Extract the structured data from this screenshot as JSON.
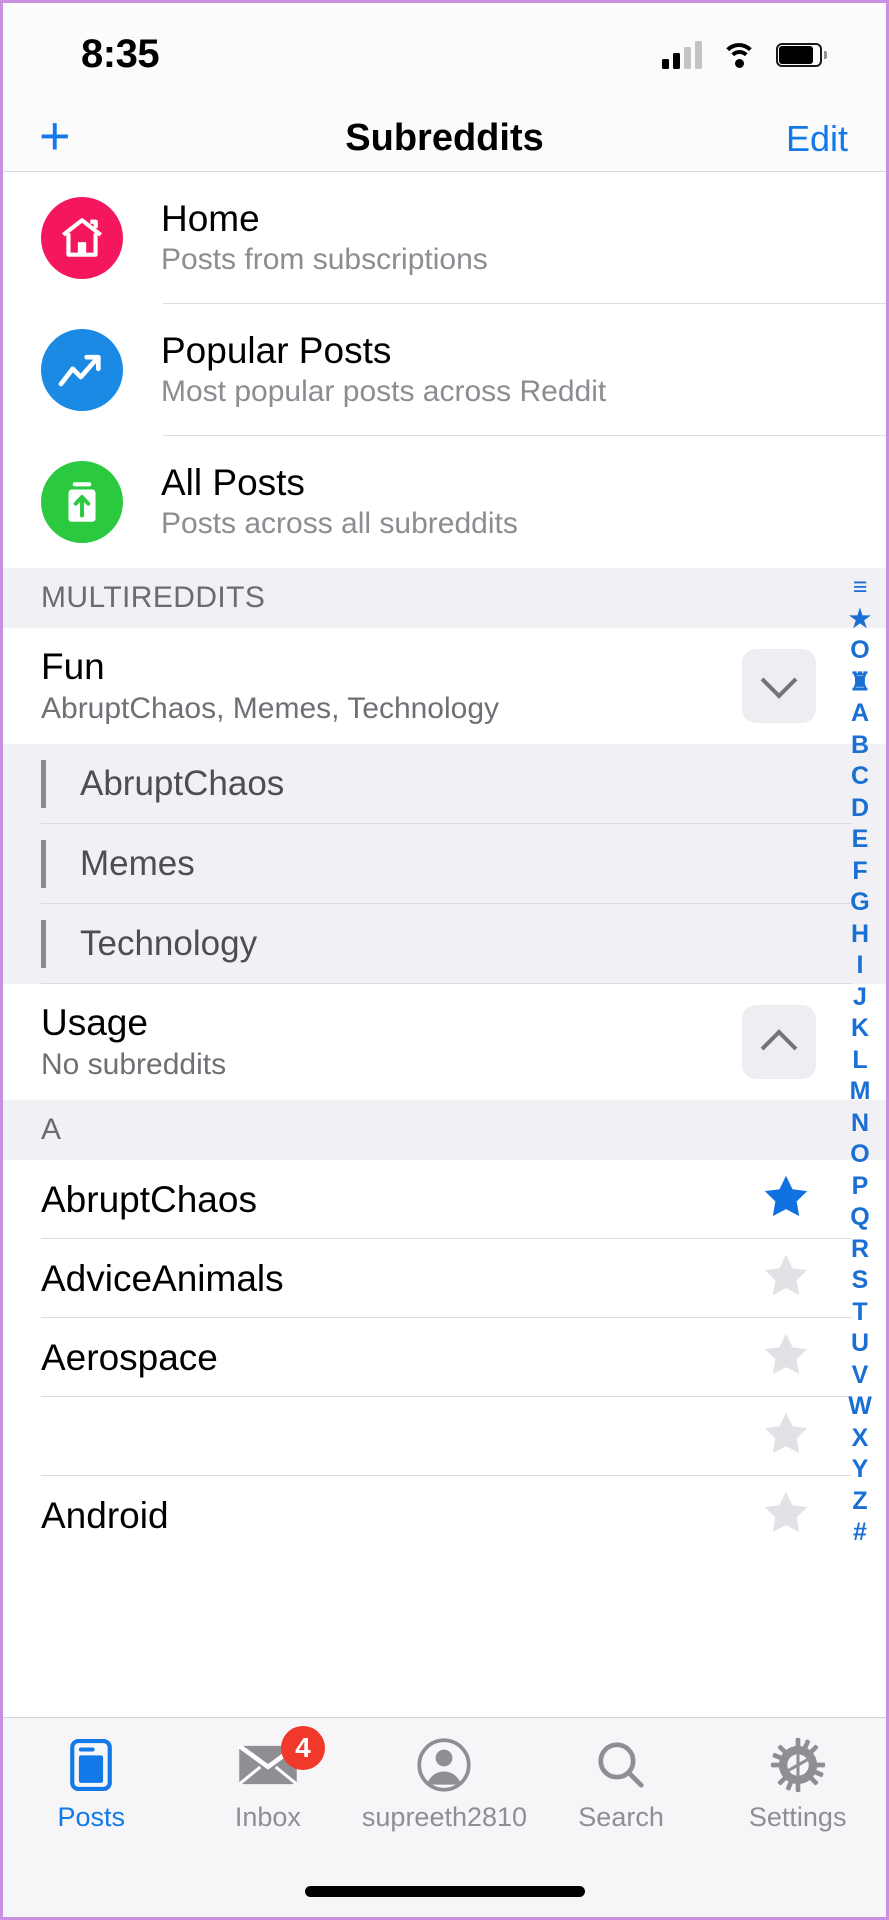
{
  "status_bar": {
    "time": "8:35",
    "cellular_icon": "cellular-signal-icon",
    "wifi_icon": "wifi-icon",
    "battery_icon": "battery-icon"
  },
  "nav_bar": {
    "add_label": "+",
    "title": "Subreddits",
    "edit_label": "Edit"
  },
  "quick_links": [
    {
      "title": "Home",
      "subtitle": "Posts from subscriptions",
      "icon": "home-icon",
      "color": "#f4175e"
    },
    {
      "title": "Popular Posts",
      "subtitle": "Most popular posts across Reddit",
      "icon": "trending-up-icon",
      "color": "#1b8ae4"
    },
    {
      "title": "All Posts",
      "subtitle": "Posts across all subreddits",
      "icon": "upload-box-icon",
      "color": "#2bc940"
    }
  ],
  "multireddits_header": "MULTIREDDITS",
  "multireddits": [
    {
      "title": "Fun",
      "subtitle": "AbruptChaos, Memes, Technology",
      "expanded": true,
      "chevron": "chevron-down-icon",
      "children": [
        "AbruptChaos",
        "Memes",
        "Technology"
      ]
    },
    {
      "title": "Usage",
      "subtitle": "No subreddits",
      "expanded": false,
      "chevron": "chevron-up-icon",
      "children": []
    }
  ],
  "alpha_section_header": "A",
  "subreddits": [
    {
      "name": "AbruptChaos",
      "favorite": true
    },
    {
      "name": "AdviceAnimals",
      "favorite": false
    },
    {
      "name": "Aerospace",
      "favorite": false
    },
    {
      "name": "",
      "favorite": false
    },
    {
      "name": "Android",
      "favorite": false
    }
  ],
  "index_bar": {
    "entries": [
      "≡",
      "★",
      "O",
      "♜",
      "A",
      "B",
      "C",
      "D",
      "E",
      "F",
      "G",
      "H",
      "I",
      "J",
      "K",
      "L",
      "M",
      "N",
      "O",
      "P",
      "Q",
      "R",
      "S",
      "T",
      "U",
      "V",
      "W",
      "X",
      "Y",
      "Z",
      "#"
    ],
    "color": "#1a6fd4"
  },
  "tab_bar": {
    "tabs": [
      {
        "label": "Posts",
        "icon": "posts-icon",
        "active": true,
        "badge": ""
      },
      {
        "label": "Inbox",
        "icon": "envelope-icon",
        "active": false,
        "badge": "4"
      },
      {
        "label": "supreeth2810",
        "icon": "account-icon",
        "active": false,
        "badge": ""
      },
      {
        "label": "Search",
        "icon": "search-icon",
        "active": false,
        "badge": ""
      },
      {
        "label": "Settings",
        "icon": "gear-icon",
        "active": false,
        "badge": ""
      }
    ],
    "active_color": "#1379e8",
    "inactive_color": "#8e8e94",
    "badge_color": "#f0392b"
  },
  "colors": {
    "accent": "#1379e8",
    "favorite_star": "#1072e0",
    "inactive_star": "#e2e2e6",
    "section_bg": "#f1f1f5"
  }
}
